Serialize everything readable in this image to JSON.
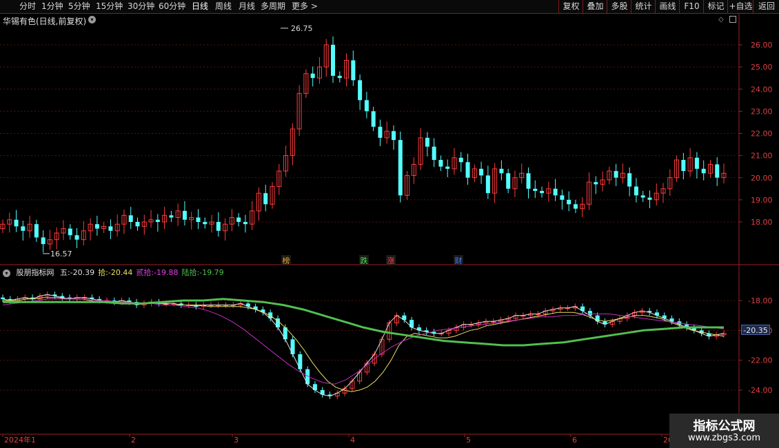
{
  "toolbar": {
    "periods": [
      "分时",
      "1分钟",
      "5分钟",
      "15分钟",
      "30分钟",
      "60分钟",
      "日线",
      "周线",
      "月线",
      "多周期",
      "更多 >"
    ],
    "active": "日线",
    "right_buttons": [
      "复权",
      "叠加",
      "多股",
      "统计",
      "画线",
      "F10",
      "标记",
      "+自选",
      "返回"
    ]
  },
  "stock": {
    "title": "华锡有色(日线,前复权)",
    "high_label": "26.75",
    "low_label": "16.57"
  },
  "markers": [
    "榜",
    "跌",
    "涨",
    "财"
  ],
  "indicator": {
    "name": "股朋指标网",
    "items": [
      {
        "label": "五:",
        "value": "-20.39",
        "color": "#e0e0e0"
      },
      {
        "label": "拾:",
        "value": "-20.44",
        "color": "#e8e060"
      },
      {
        "label": "贰拾:",
        "value": "-19.88",
        "color": "#e040e0"
      },
      {
        "label": "陆拾:",
        "value": "-19.79",
        "color": "#50c050"
      }
    ],
    "current": "-20.35"
  },
  "axes": {
    "price_ticks": [
      "26.00",
      "25.00",
      "24.00",
      "23.00",
      "22.00",
      "21.00",
      "20.00",
      "19.00",
      "18.00"
    ],
    "ind_ticks": [
      "-18.00",
      "-20.00",
      "-22.00",
      "-24.00"
    ],
    "months": [
      "2024年1",
      "2",
      "3",
      "4",
      "5",
      "6",
      "20"
    ]
  },
  "watermark": {
    "line1": "指标公式网",
    "line2": "www.zbgs3.com"
  },
  "colors": {
    "up": "#ff3c3c",
    "down": "#54ffff",
    "grid": "#5a1010",
    "border": "#a02020"
  },
  "chart_data": {
    "type": "candlestick",
    "price_closes": [
      17.9,
      18.1,
      17.8,
      17.6,
      17.9,
      17.3,
      17.0,
      17.2,
      17.5,
      17.7,
      17.4,
      17.2,
      17.6,
      17.9,
      17.7,
      17.8,
      17.6,
      17.9,
      18.3,
      18.0,
      17.8,
      18.0,
      18.1,
      18.0,
      18.3,
      18.2,
      18.5,
      18.1,
      18.2,
      18.0,
      17.9,
      18.0,
      17.6,
      17.9,
      18.2,
      18.0,
      17.9,
      18.5,
      19.3,
      18.8,
      19.6,
      20.3,
      21.0,
      22.2,
      23.8,
      24.7,
      24.5,
      25.0,
      26.0,
      24.6,
      24.5,
      25.3,
      24.4,
      23.5,
      23.0,
      22.3,
      21.8,
      22.1,
      21.7,
      19.2,
      20.1,
      20.6,
      21.8,
      21.4,
      20.8,
      20.5,
      20.4,
      20.9,
      20.7,
      20.0,
      20.4,
      20.1,
      19.3,
      20.4,
      20.2,
      19.5,
      20.0,
      20.2,
      19.5,
      19.4,
      19.3,
      19.5,
      19.2,
      19.0,
      18.8,
      18.6,
      18.8,
      19.8,
      19.7,
      19.9,
      20.3,
      20.0,
      20.2,
      19.6,
      19.2,
      19.1,
      19.0,
      19.3,
      19.5,
      20.0,
      20.8,
      20.3,
      20.9,
      20.4,
      20.2,
      20.6,
      20.0,
      20.2
    ],
    "ind_series": [
      {
        "name": "五",
        "values": [
          -17.9,
          -18.0,
          -17.9,
          -17.8,
          -17.9,
          -17.7,
          -17.6,
          -17.7,
          -17.8,
          -17.9,
          -17.8,
          -17.8,
          -17.9,
          -18.0,
          -18.0,
          -18.1,
          -18.0,
          -18.1,
          -18.3,
          -18.2,
          -18.1,
          -18.2,
          -18.2,
          -18.2,
          -18.3,
          -18.3,
          -18.4,
          -18.3,
          -18.3,
          -18.3,
          -18.3,
          -18.3,
          -18.2,
          -18.4,
          -18.6,
          -18.8,
          -19.2,
          -19.8,
          -20.6,
          -21.6,
          -22.6,
          -23.6,
          -24.0,
          -24.3,
          -24.4,
          -24.2,
          -23.9,
          -23.4,
          -22.8,
          -22.2,
          -21.6,
          -20.6,
          -19.5,
          -19.0,
          -19.3,
          -19.8,
          -20.0,
          -20.1,
          -20.2,
          -20.2,
          -20.0,
          -19.8,
          -19.6,
          -19.6,
          -19.5,
          -19.4,
          -19.4,
          -19.3,
          -19.2,
          -19.0,
          -19.0,
          -18.9,
          -18.9,
          -18.7,
          -18.6,
          -18.5,
          -18.5,
          -18.4,
          -18.7,
          -19.0,
          -19.4,
          -19.6,
          -19.4,
          -19.2,
          -19.0,
          -18.8,
          -18.7,
          -18.8,
          -19.0,
          -19.2,
          -19.4,
          -19.6,
          -19.8,
          -20.0,
          -20.2,
          -20.4,
          -20.3,
          -20.2
        ]
      },
      {
        "name": "拾",
        "values": [
          -18.0,
          -18.0,
          -18.0,
          -17.9,
          -17.9,
          -17.8,
          -17.8,
          -17.8,
          -17.9,
          -17.9,
          -17.9,
          -18.0,
          -18.0,
          -18.1,
          -18.1,
          -18.1,
          -18.1,
          -18.2,
          -18.2,
          -18.2,
          -18.2,
          -18.3,
          -18.3,
          -18.3,
          -18.3,
          -18.3,
          -18.4,
          -18.4,
          -18.4,
          -18.4,
          -18.4,
          -18.5,
          -18.6,
          -18.8,
          -19.1,
          -19.5,
          -20.0,
          -20.6,
          -21.3,
          -22.1,
          -22.8,
          -23.4,
          -23.8,
          -24.0,
          -24.1,
          -24.0,
          -23.8,
          -23.4,
          -22.8,
          -22.0,
          -21.0,
          -20.4,
          -20.2,
          -20.3,
          -20.4,
          -20.5,
          -20.5,
          -20.4,
          -20.2,
          -20.0,
          -19.9,
          -19.7,
          -19.6,
          -19.5,
          -19.4,
          -19.3,
          -19.2,
          -19.1,
          -19.0,
          -18.9,
          -18.8,
          -18.8,
          -18.8,
          -18.9,
          -19.1,
          -19.3,
          -19.4,
          -19.3,
          -19.2,
          -19.1,
          -19.0,
          -19.0,
          -19.1,
          -19.2,
          -19.4,
          -19.6,
          -19.8,
          -20.0,
          -20.1,
          -20.2,
          -20.3,
          -20.4
        ]
      },
      {
        "name": "贰拾",
        "values": [
          -18.3,
          -18.2,
          -18.1,
          -18.0,
          -17.9,
          -17.9,
          -17.9,
          -17.9,
          -18.0,
          -18.0,
          -18.1,
          -18.1,
          -18.2,
          -18.2,
          -18.3,
          -18.3,
          -18.4,
          -18.5,
          -18.7,
          -19.0,
          -19.4,
          -19.9,
          -20.5,
          -21.1,
          -21.7,
          -22.3,
          -22.8,
          -23.2,
          -23.5,
          -23.6,
          -23.3,
          -22.8,
          -22.2,
          -21.6,
          -21.1,
          -20.7,
          -20.4,
          -20.2,
          -20.0,
          -19.9,
          -19.8,
          -19.7,
          -19.6,
          -19.5,
          -19.4,
          -19.3,
          -19.2,
          -19.1,
          -19.1,
          -19.0,
          -19.0,
          -18.9,
          -18.9,
          -18.9,
          -19.0,
          -19.1,
          -19.2,
          -19.3,
          -19.4,
          -19.5,
          -19.6,
          -19.7,
          -19.8,
          -19.9
        ]
      },
      {
        "name": "陆拾",
        "values": [
          -18.1,
          -18.1,
          -18.1,
          -18.1,
          -18.1,
          -18.1,
          -18.2,
          -18.2,
          -18.1,
          -18.0,
          -18.0,
          -17.9,
          -18.0,
          -18.1,
          -18.3,
          -18.6,
          -19.0,
          -19.4,
          -19.8,
          -20.1,
          -20.3,
          -20.5,
          -20.7,
          -20.8,
          -20.9,
          -21.0,
          -21.0,
          -20.9,
          -20.8,
          -20.6,
          -20.4,
          -20.2,
          -20.0,
          -19.9,
          -19.8,
          -19.8,
          -19.8
        ]
      }
    ]
  }
}
